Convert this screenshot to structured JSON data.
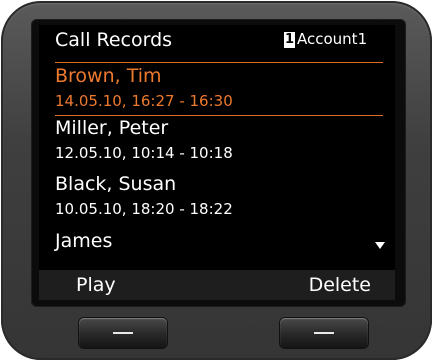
{
  "header": {
    "title": "Call Records",
    "account_number": "1",
    "account_name": "Account1"
  },
  "records": [
    {
      "name": "Brown, Tim",
      "time": "14.05.10, 16:27 - 16:30",
      "selected": true
    },
    {
      "name": "Miller, Peter",
      "time": "12.05.10, 10:14 - 10:18",
      "selected": false
    },
    {
      "name": "Black, Susan",
      "time": "10.05.10, 18:20 - 18:22",
      "selected": false
    },
    {
      "name": "James",
      "selected": false
    }
  ],
  "softkeys": {
    "left": "Play",
    "right": "Delete"
  },
  "colors": {
    "accent": "#ee7a2e",
    "screen_bg": "#000000",
    "softbar_bg": "#1e1e1e"
  },
  "icons": {
    "scroll_more": "scroll-down-arrow-icon",
    "key_line": "softkey-line-icon"
  }
}
